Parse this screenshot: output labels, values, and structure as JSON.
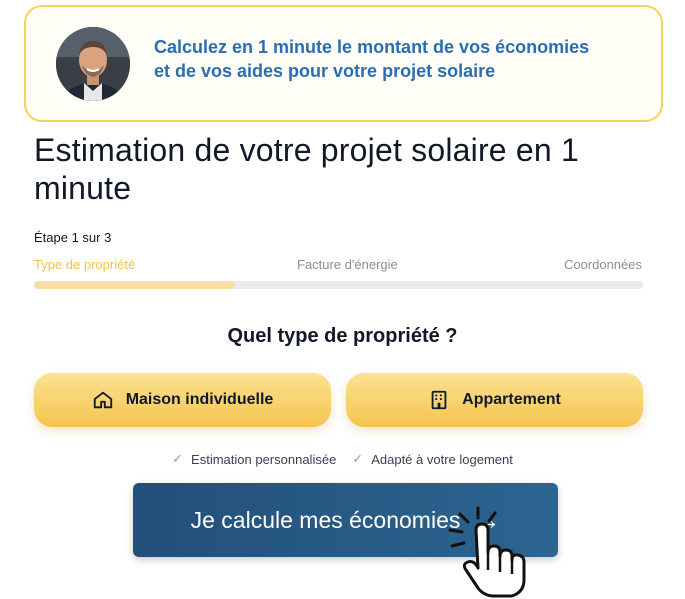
{
  "banner": {
    "line1": "Calculez en 1 minute le montant de vos économies",
    "line2": "et de vos aides pour votre projet solaire",
    "text_color": "#2a6db3",
    "border_color": "#f3d35a"
  },
  "page": {
    "title": "Estimation de votre projet solaire en 1 minute"
  },
  "stepper": {
    "counter": "Étape 1 sur 3",
    "progress": 0.33,
    "steps": [
      {
        "label": "Type de propriété",
        "active": true
      },
      {
        "label": "Facture d'énergie",
        "active": false
      },
      {
        "label": "Coordonnées",
        "active": false
      }
    ]
  },
  "question": {
    "text": "Quel type de propriété ?"
  },
  "choices": [
    {
      "label": "Maison individuelle",
      "icon": "house-icon"
    },
    {
      "label": "Appartement",
      "icon": "apartment-icon"
    }
  ],
  "features": [
    {
      "label": "Estimation personnalisée",
      "icon": "check-icon"
    },
    {
      "label": "Adapté à votre logement",
      "icon": "check-icon"
    }
  ],
  "cta": {
    "label": "Je calcule mes économies",
    "icon": "arrow-right-icon",
    "color": "#234f7a"
  },
  "accent_color": "#f6c44f"
}
